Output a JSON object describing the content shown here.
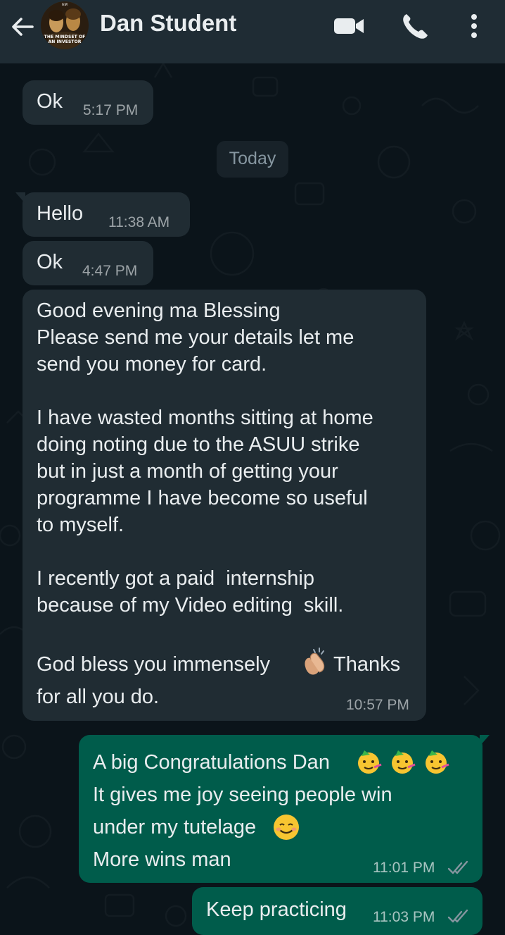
{
  "header": {
    "contact_name": "Dan Student",
    "avatar_caption_line1": "THE MINDSET OF",
    "avatar_caption_line2": "AN INVESTOR",
    "avatar_badge": "EM",
    "icons": [
      "back-arrow-icon",
      "avatar",
      "video-call-icon",
      "voice-call-icon",
      "more-options-icon"
    ]
  },
  "date_divider": "Today",
  "messages": [
    {
      "direction": "incoming",
      "text": "Ok",
      "time": "5:17 PM"
    },
    {
      "direction": "incoming",
      "text": "Hello",
      "time": "11:38 AM"
    },
    {
      "direction": "incoming",
      "text": "Ok",
      "time": "4:47 PM"
    },
    {
      "direction": "incoming",
      "lines": [
        "Good evening ma Blessing",
        "Please send me your details let me",
        "send you money for card.",
        "",
        "I have wasted months sitting at home",
        "doing noting due to the ASUU strike",
        "but in just a month of getting your",
        "programme I have become so useful",
        "to myself.",
        "",
        "I recently got a paid  internship",
        "because of my Video editing  skill.",
        "",
        "God bless you immensely",
        "Thanks",
        "for all you do."
      ],
      "emoji": "clapping-hands-emoji",
      "time": "10:57 PM"
    },
    {
      "direction": "outgoing",
      "lines": [
        "A big Congratulations Dan",
        "It gives me joy seeing people win",
        "under my tutelage",
        "More wins man"
      ],
      "emojis": [
        "partying-face-emoji",
        "partying-face-emoji",
        "partying-face-emoji",
        "smiling-face-emoji"
      ],
      "time": "11:01 PM",
      "status": "read"
    },
    {
      "direction": "outgoing",
      "text": "Keep practicing",
      "time": "11:03 PM",
      "status": "read"
    }
  ],
  "colors": {
    "background": "#0b141a",
    "header": "#1f2c34",
    "incoming_bubble": "#202c33",
    "outgoing_bubble": "#005c4b",
    "read_tick": "#8696a0"
  }
}
